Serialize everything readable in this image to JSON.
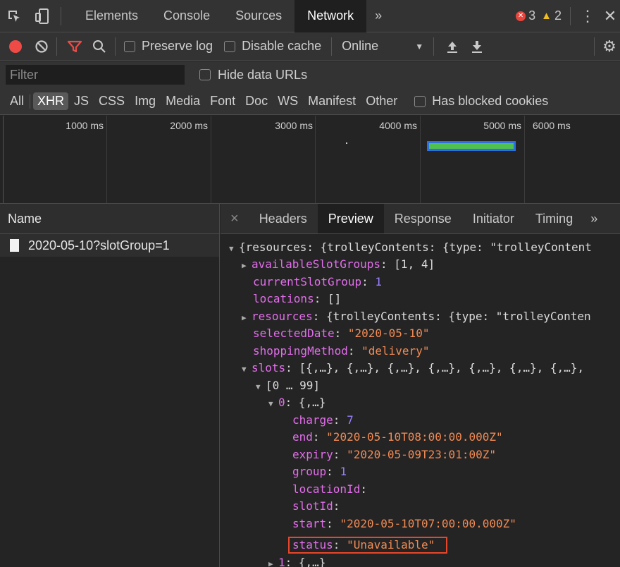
{
  "topbar": {
    "tabs": [
      "Elements",
      "Console",
      "Sources",
      "Network"
    ],
    "more": "»",
    "errors": "3",
    "warnings": "2"
  },
  "toolbar": {
    "preserve_log": "Preserve log",
    "disable_cache": "Disable cache",
    "throttle": "Online"
  },
  "filter": {
    "placeholder": "Filter",
    "hide_data_urls": "Hide data URLs"
  },
  "types": [
    "All",
    "XHR",
    "JS",
    "CSS",
    "Img",
    "Media",
    "Font",
    "Doc",
    "WS",
    "Manifest",
    "Other"
  ],
  "has_blocked_cookies": "Has blocked cookies",
  "timeline": {
    "ticks": [
      "1000 ms",
      "2000 ms",
      "3000 ms",
      "4000 ms",
      "5000 ms",
      "6000 ms"
    ]
  },
  "left": {
    "header": "Name",
    "request": "2020-05-10?slotGroup=1"
  },
  "detail": {
    "close": "×",
    "tabs": [
      "Headers",
      "Preview",
      "Response",
      "Initiator",
      "Timing"
    ],
    "more": "»"
  },
  "preview": {
    "root": "{resources: {trolleyContents: {type: \"trolleyContent",
    "available_slot_groups_key": "availableSlotGroups",
    "available_slot_groups_val": "[1, 4]",
    "current_slot_group_key": "currentSlotGroup",
    "current_slot_group_val": "1",
    "locations_key": "locations",
    "locations_val": "[]",
    "resources_key": "resources",
    "resources_val": "{trolleyContents: {type: \"trolleyConten",
    "selected_date_key": "selectedDate",
    "selected_date_val": "\"2020-05-10\"",
    "shopping_method_key": "shoppingMethod",
    "shopping_method_val": "\"delivery\"",
    "slots_key": "slots",
    "slots_val": "[{,…}, {,…}, {,…}, {,…}, {,…}, {,…}, {,…},",
    "range": "[0 … 99]",
    "item0_key": "0",
    "item0_val": "{,…}",
    "charge_key": "charge",
    "charge_val": "7",
    "end_key": "end",
    "end_val": "\"2020-05-10T08:00:00.000Z\"",
    "expiry_key": "expiry",
    "expiry_val": "\"2020-05-09T23:01:00Z\"",
    "group_key": "group",
    "group_val": "1",
    "location_id_key": "locationId",
    "slot_id_key": "slotId",
    "start_key": "start",
    "start_val": "\"2020-05-10T07:00:00.000Z\"",
    "status_key": "status",
    "status_val": "\"Unavailable\"",
    "item1_key": "1",
    "item1_val": "{,…}"
  }
}
